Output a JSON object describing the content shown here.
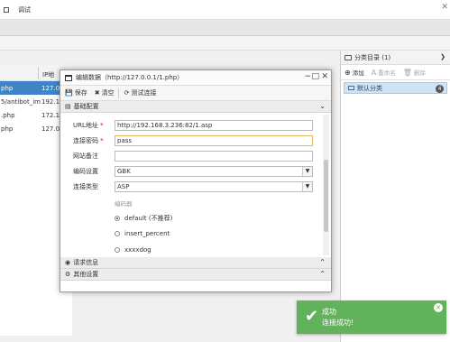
{
  "menubar": {
    "item1": "",
    "item2": "调试"
  },
  "left_table": {
    "header_ip": "IP地",
    "rows": [
      {
        "c1": "php",
        "c2": "127.0",
        "selected": true
      },
      {
        "c1": "5/antibot_im",
        "c2": "192.1",
        "selected": false
      },
      {
        "c1": ".php",
        "c2": "172.1",
        "selected": false
      },
      {
        "c1": "php",
        "c2": "127.0",
        "selected": false
      }
    ]
  },
  "right_panel": {
    "title": "分类目录 (1)",
    "tools": {
      "add": "添加",
      "rename": "重命名",
      "delete": "删除"
    },
    "item": {
      "label": "默认分类",
      "count": "4"
    }
  },
  "dialog": {
    "title": "编辑数据（http://127.0.0.1/1.php）",
    "toolbar": {
      "save": "保存",
      "clear": "清空",
      "test": "测试连接"
    },
    "sections": {
      "basic": "基础配置",
      "request": "请求信息",
      "other": "其他设置"
    },
    "form": {
      "url_label": "URL地址",
      "url_value": "http://192.168.3.236:82/1.asp",
      "pwd_label": "连接密码",
      "pwd_value": "pass",
      "note_label": "网站备注",
      "note_value": "",
      "encoding_label": "编码设置",
      "encoding_value": "GBK",
      "type_label": "连接类型",
      "type_value": "ASP",
      "encoder_legend": "编码器",
      "encoders": [
        {
          "label": "default (不推荐)",
          "selected": true
        },
        {
          "label": "insert_percent",
          "selected": false
        },
        {
          "label": "xxxxdog",
          "selected": false
        }
      ]
    }
  },
  "toast": {
    "title": "成功",
    "message": "连接成功!"
  },
  "colors": {
    "selection": "#3e84c6",
    "toast_bg": "#62b15b"
  }
}
